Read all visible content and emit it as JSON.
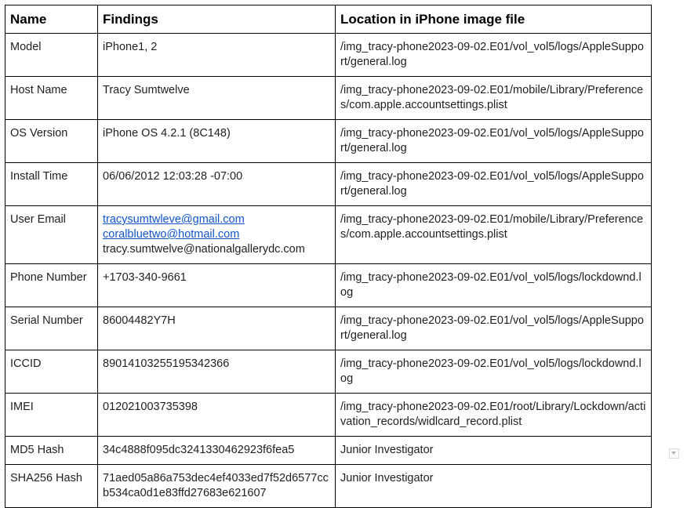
{
  "headers": {
    "name": "Name",
    "findings": "Findings",
    "location": "Location in iPhone image file"
  },
  "rows": [
    {
      "name": "Model",
      "findings": "iPhone1, 2",
      "location": "/img_tracy-phone2023-09-02.E01/vol_vol5/logs/AppleSupport/general.log"
    },
    {
      "name": "Host Name",
      "findings": "Tracy Sumtwelve",
      "location": "/img_tracy-phone2023-09-02.E01/mobile/Library/Preferences/com.apple.accountsettings.plist"
    },
    {
      "name": "OS Version",
      "findings": "iPhone OS 4.2.1 (8C148)",
      "location": "/img_tracy-phone2023-09-02.E01/vol_vol5/logs/AppleSupport/general.log"
    },
    {
      "name": "Install Time",
      "findings": "06/06/2012 12:03:28 -07:00",
      "location": "/img_tracy-phone2023-09-02.E01/vol_vol5/logs/AppleSupport/general.log"
    },
    {
      "name": "User Email",
      "email1": "tracysumtwleve@gmail.com",
      "email2": "coralbluetwo@hotmail.com",
      "email3": "tracy.sumtwelve@nationalgallerydc.com",
      "location": "/img_tracy-phone2023-09-02.E01/mobile/Library/Preferences/com.apple.accountsettings.plist"
    },
    {
      "name": "Phone Number",
      "findings": "+1703-340-9661",
      "location": "/img_tracy-phone2023-09-02.E01/vol_vol5/logs/lockdownd.log"
    },
    {
      "name": "Serial Number",
      "findings": "86004482Y7H",
      "location": "/img_tracy-phone2023-09-02.E01/vol_vol5/logs/AppleSupport/general.log"
    },
    {
      "name": "ICCID",
      "findings": "89014103255195342366",
      "location": "/img_tracy-phone2023-09-02.E01/vol_vol5/logs/lockdownd.log"
    },
    {
      "name": "IMEI",
      "findings": "012021003735398",
      "location": "/img_tracy-phone2023-09-02.E01/root/Library/Lockdown/activation_records/widlcard_record.plist"
    },
    {
      "name": "MD5 Hash",
      "findings": "34c4888f095dc3241330462923f6fea5",
      "location": "Junior Investigator"
    },
    {
      "name": "SHA256 Hash",
      "findings": "71aed05a86a753dec4ef4033ed7f52d6577ccb534ca0d1e83ffd27683e621607",
      "location": "Junior Investigator"
    }
  ]
}
